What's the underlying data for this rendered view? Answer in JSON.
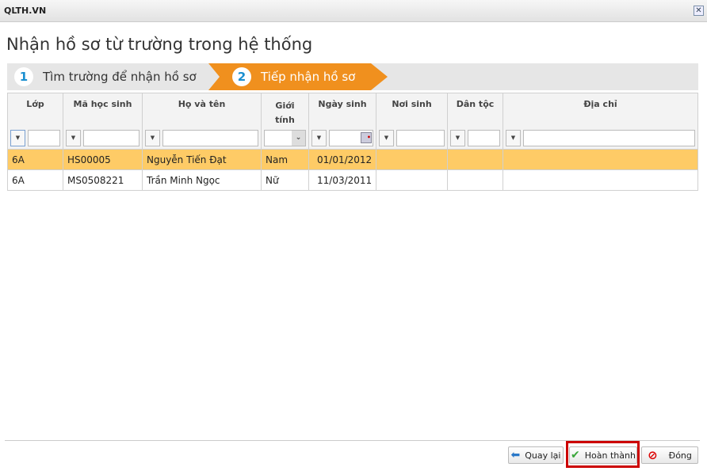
{
  "window": {
    "title": "QLTH.VN"
  },
  "heading": "Nhận hồ sơ từ trường trong hệ thống",
  "steps": [
    {
      "num": "1",
      "label": "Tìm trường để nhận hồ sơ"
    },
    {
      "num": "2",
      "label": "Tiếp nhận hồ sơ"
    }
  ],
  "table": {
    "headers": [
      "Lớp",
      "Mã học sinh",
      "Họ và tên",
      "Giới tính",
      "Ngày sinh",
      "Nơi sinh",
      "Dân tộc",
      "Địa chỉ"
    ],
    "rows": [
      [
        "6A",
        "HS00005",
        "Nguyễn Tiến Đạt",
        "Nam",
        "01/01/2012",
        "",
        "",
        ""
      ],
      [
        "6A",
        "MS0508221",
        "Trần Minh Ngọc",
        "Nữ",
        "11/03/2011",
        "",
        "",
        ""
      ]
    ]
  },
  "buttons": {
    "back": "Quay lại",
    "finish": "Hoàn thành",
    "close": "Đóng"
  },
  "colors": {
    "accent": "#f0901e",
    "selected_row": "#fecb66",
    "highlight": "#cc0000"
  }
}
